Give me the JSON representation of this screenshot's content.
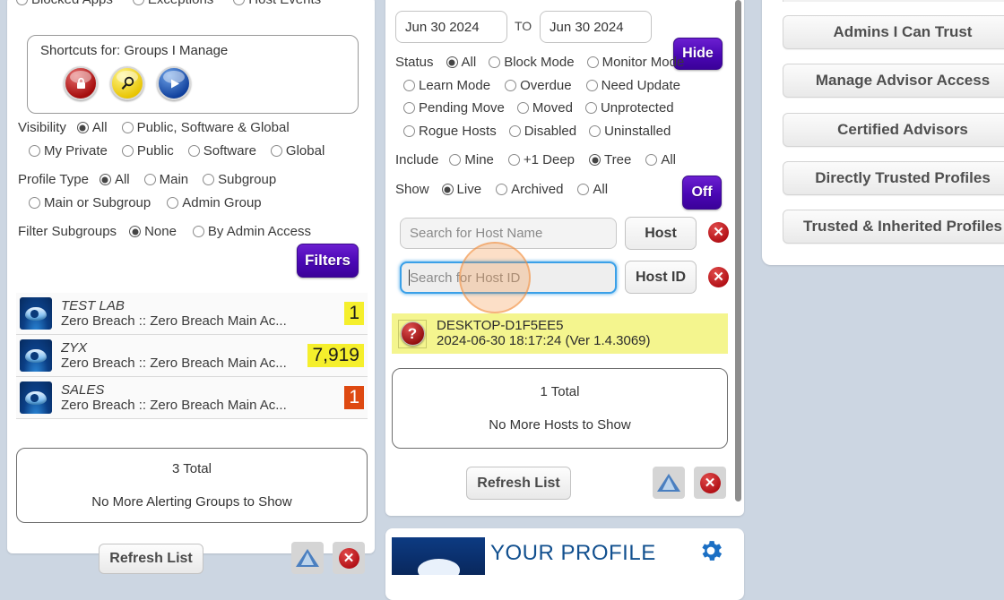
{
  "left_panel": {
    "top_cut_options": [
      "Blocked Apps",
      "Exceptions",
      "Host Events"
    ],
    "shortcuts": {
      "title": "Shortcuts for: Groups I Manage",
      "buttons": [
        {
          "name": "lock-icon",
          "glyph": "▮"
        },
        {
          "name": "magnifier-icon",
          "glyph": "⚲"
        },
        {
          "name": "play-icon",
          "glyph": "▶"
        }
      ]
    },
    "visibility": {
      "label": "Visibility",
      "options": [
        {
          "label": "All",
          "selected": true
        },
        {
          "label": "Public, Software & Global",
          "selected": false
        },
        {
          "label": "My Private",
          "selected": false
        },
        {
          "label": "Public",
          "selected": false
        },
        {
          "label": "Software",
          "selected": false
        },
        {
          "label": "Global",
          "selected": false
        }
      ]
    },
    "profile_type": {
      "label": "Profile Type",
      "options": [
        {
          "label": "All",
          "selected": true
        },
        {
          "label": "Main",
          "selected": false
        },
        {
          "label": "Subgroup",
          "selected": false
        },
        {
          "label": "Main or Subgroup",
          "selected": false
        },
        {
          "label": "Admin Group",
          "selected": false
        }
      ]
    },
    "filter_subgroups": {
      "label": "Filter Subgroups",
      "options": [
        {
          "label": "None",
          "selected": true
        },
        {
          "label": "By Admin Access",
          "selected": false
        }
      ]
    },
    "filters_button": "Filters",
    "groups": [
      {
        "name": "TEST LAB",
        "path": "Zero Breach :: Zero Breach Main Ac...",
        "badge": "1",
        "badge_style": "yellow"
      },
      {
        "name": "ZYX",
        "path": "Zero Breach :: Zero Breach Main Ac...",
        "badge": "7,919",
        "badge_style": "yellow"
      },
      {
        "name": "SALES",
        "path": "Zero Breach :: Zero Breach Main Ac...",
        "badge": "1",
        "badge_style": "orange"
      }
    ],
    "total": {
      "count": "3 Total",
      "message": "No More Alerting Groups to Show"
    },
    "refresh_label": "Refresh List"
  },
  "mid_panel": {
    "date_from": "Jun 30 2024",
    "date_to_label": "TO",
    "date_to": "Jun 30 2024",
    "hide_button": "Hide",
    "status": {
      "label": "Status",
      "options": [
        {
          "label": "All",
          "selected": true
        },
        {
          "label": "Block Mode",
          "selected": false
        },
        {
          "label": "Monitor Mode",
          "selected": false
        },
        {
          "label": "Learn Mode",
          "selected": false
        },
        {
          "label": "Overdue",
          "selected": false
        },
        {
          "label": "Need Update",
          "selected": false
        },
        {
          "label": "Pending Move",
          "selected": false
        },
        {
          "label": "Moved",
          "selected": false
        },
        {
          "label": "Unprotected",
          "selected": false
        },
        {
          "label": "Rogue Hosts",
          "selected": false
        },
        {
          "label": "Disabled",
          "selected": false
        },
        {
          "label": "Uninstalled",
          "selected": false
        }
      ]
    },
    "include": {
      "label": "Include",
      "options": [
        {
          "label": "Mine",
          "selected": false
        },
        {
          "label": "+1 Deep",
          "selected": false
        },
        {
          "label": "Tree",
          "selected": true
        },
        {
          "label": "All",
          "selected": false
        }
      ]
    },
    "show": {
      "label": "Show",
      "options": [
        {
          "label": "Live",
          "selected": true
        },
        {
          "label": "Archived",
          "selected": false
        },
        {
          "label": "All",
          "selected": false
        }
      ]
    },
    "off_button": "Off",
    "host_search": {
      "placeholder": "Search for Host Name",
      "value": "",
      "button": "Host"
    },
    "hostid_search": {
      "placeholder": "Search for Host ID",
      "value": "",
      "button": "Host ID",
      "focused": true
    },
    "host_result": {
      "name": "DESKTOP-D1F5EE5",
      "detail": "2024-06-30 18:17:24 (Ver 1.4.3069)",
      "status_icon": "question-icon"
    },
    "total": {
      "count": "1 Total",
      "message": "No More Hosts to Show"
    },
    "refresh_label": "Refresh List",
    "profile_title": "YOUR PROFILE"
  },
  "right_panel": {
    "buttons": [
      "Admins I Can Trust",
      "Manage Advisor Access",
      "Certified Advisors",
      "Directly Trusted Profiles",
      "Trusted & Inherited Profiles"
    ]
  },
  "colors": {
    "accent_purple": "#4a07b4",
    "badge_yellow": "#f5ef2c",
    "badge_orange": "#de4911",
    "focus_blue": "#3aa0e8",
    "row_highlight": "#f4f58e",
    "page_bg": "#ccd6e2"
  }
}
